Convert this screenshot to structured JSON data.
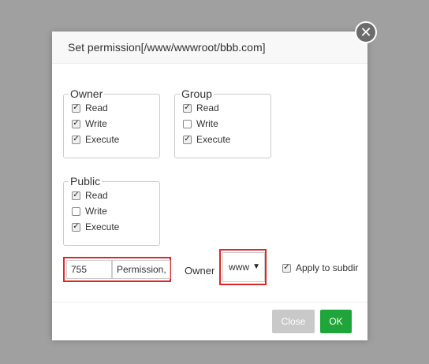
{
  "dialog": {
    "title": "Set permission[/www/wwwroot/bbb.com]",
    "close_icon": "close-x-icon"
  },
  "groups": {
    "owner": {
      "legend": "Owner",
      "read": {
        "label": "Read",
        "checked": true
      },
      "write": {
        "label": "Write",
        "checked": true
      },
      "execute": {
        "label": "Execute",
        "checked": true
      }
    },
    "group": {
      "legend": "Group",
      "read": {
        "label": "Read",
        "checked": true
      },
      "write": {
        "label": "Write",
        "checked": false
      },
      "execute": {
        "label": "Execute",
        "checked": true
      }
    },
    "public": {
      "legend": "Public",
      "read": {
        "label": "Read",
        "checked": true
      },
      "write": {
        "label": "Write",
        "checked": false
      },
      "execute": {
        "label": "Execute",
        "checked": true
      }
    }
  },
  "permission": {
    "value": "755",
    "label": "Permission,"
  },
  "owner_select": {
    "label": "Owner",
    "value": "www",
    "caret": "▼"
  },
  "apply_subdirs": {
    "label": "Apply to subdir",
    "checked": true
  },
  "footer": {
    "close_label": "Close",
    "ok_label": "OK"
  },
  "colors": {
    "ok_button": "#20a53a",
    "close_button": "#c9c9c9",
    "highlight_border": "#e02727",
    "overlay": "#a0a0a0"
  }
}
